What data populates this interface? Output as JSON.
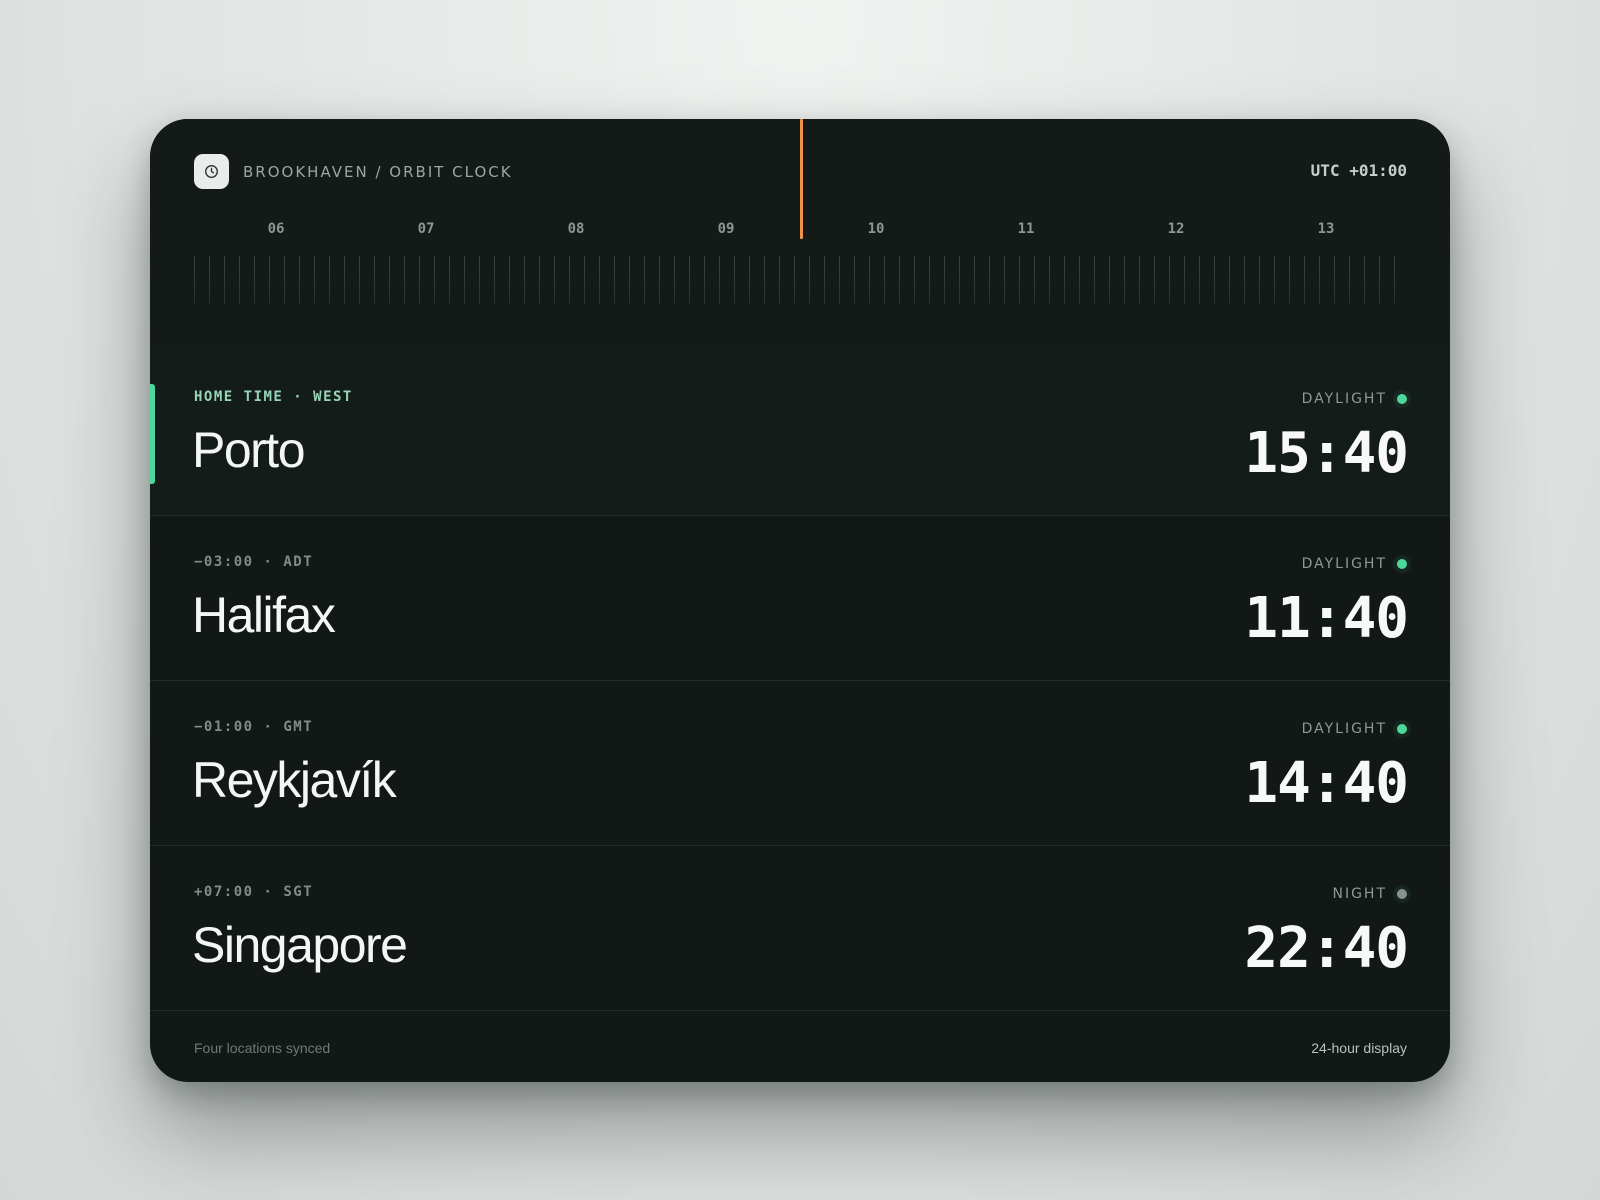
{
  "header": {
    "brand_label": "BROOKHAVEN / ORBIT CLOCK",
    "brand_icon": "clock-icon",
    "utc_offset": "UTC +01:00"
  },
  "timeline": {
    "hours": [
      "06",
      "07",
      "08",
      "09",
      "10",
      "11",
      "12",
      "13"
    ],
    "current_hour": 9.5,
    "marker_color": "#f0924a"
  },
  "locations": [
    {
      "meta": "HOME TIME · WEST",
      "city": "Porto",
      "status": "DAYLIGHT",
      "status_color": "#4fd69a",
      "time": "15:40",
      "is_home": true
    },
    {
      "meta": "−03:00 · ADT",
      "city": "Halifax",
      "status": "DAYLIGHT",
      "status_color": "#4fd69a",
      "time": "11:40",
      "is_home": false
    },
    {
      "meta": "−01:00 · GMT",
      "city": "Reykjavík",
      "status": "DAYLIGHT",
      "status_color": "#4fd69a",
      "time": "14:40",
      "is_home": false
    },
    {
      "meta": "+07:00 · SGT",
      "city": "Singapore",
      "status": "NIGHT",
      "status_color": "#8a918e",
      "time": "22:40",
      "is_home": false
    }
  ],
  "footer": {
    "left": "Four locations synced",
    "right": "24-hour display"
  },
  "colors": {
    "accent": "#4fd69a",
    "card_bg": "#121816",
    "now_marker": "#f0924a"
  }
}
